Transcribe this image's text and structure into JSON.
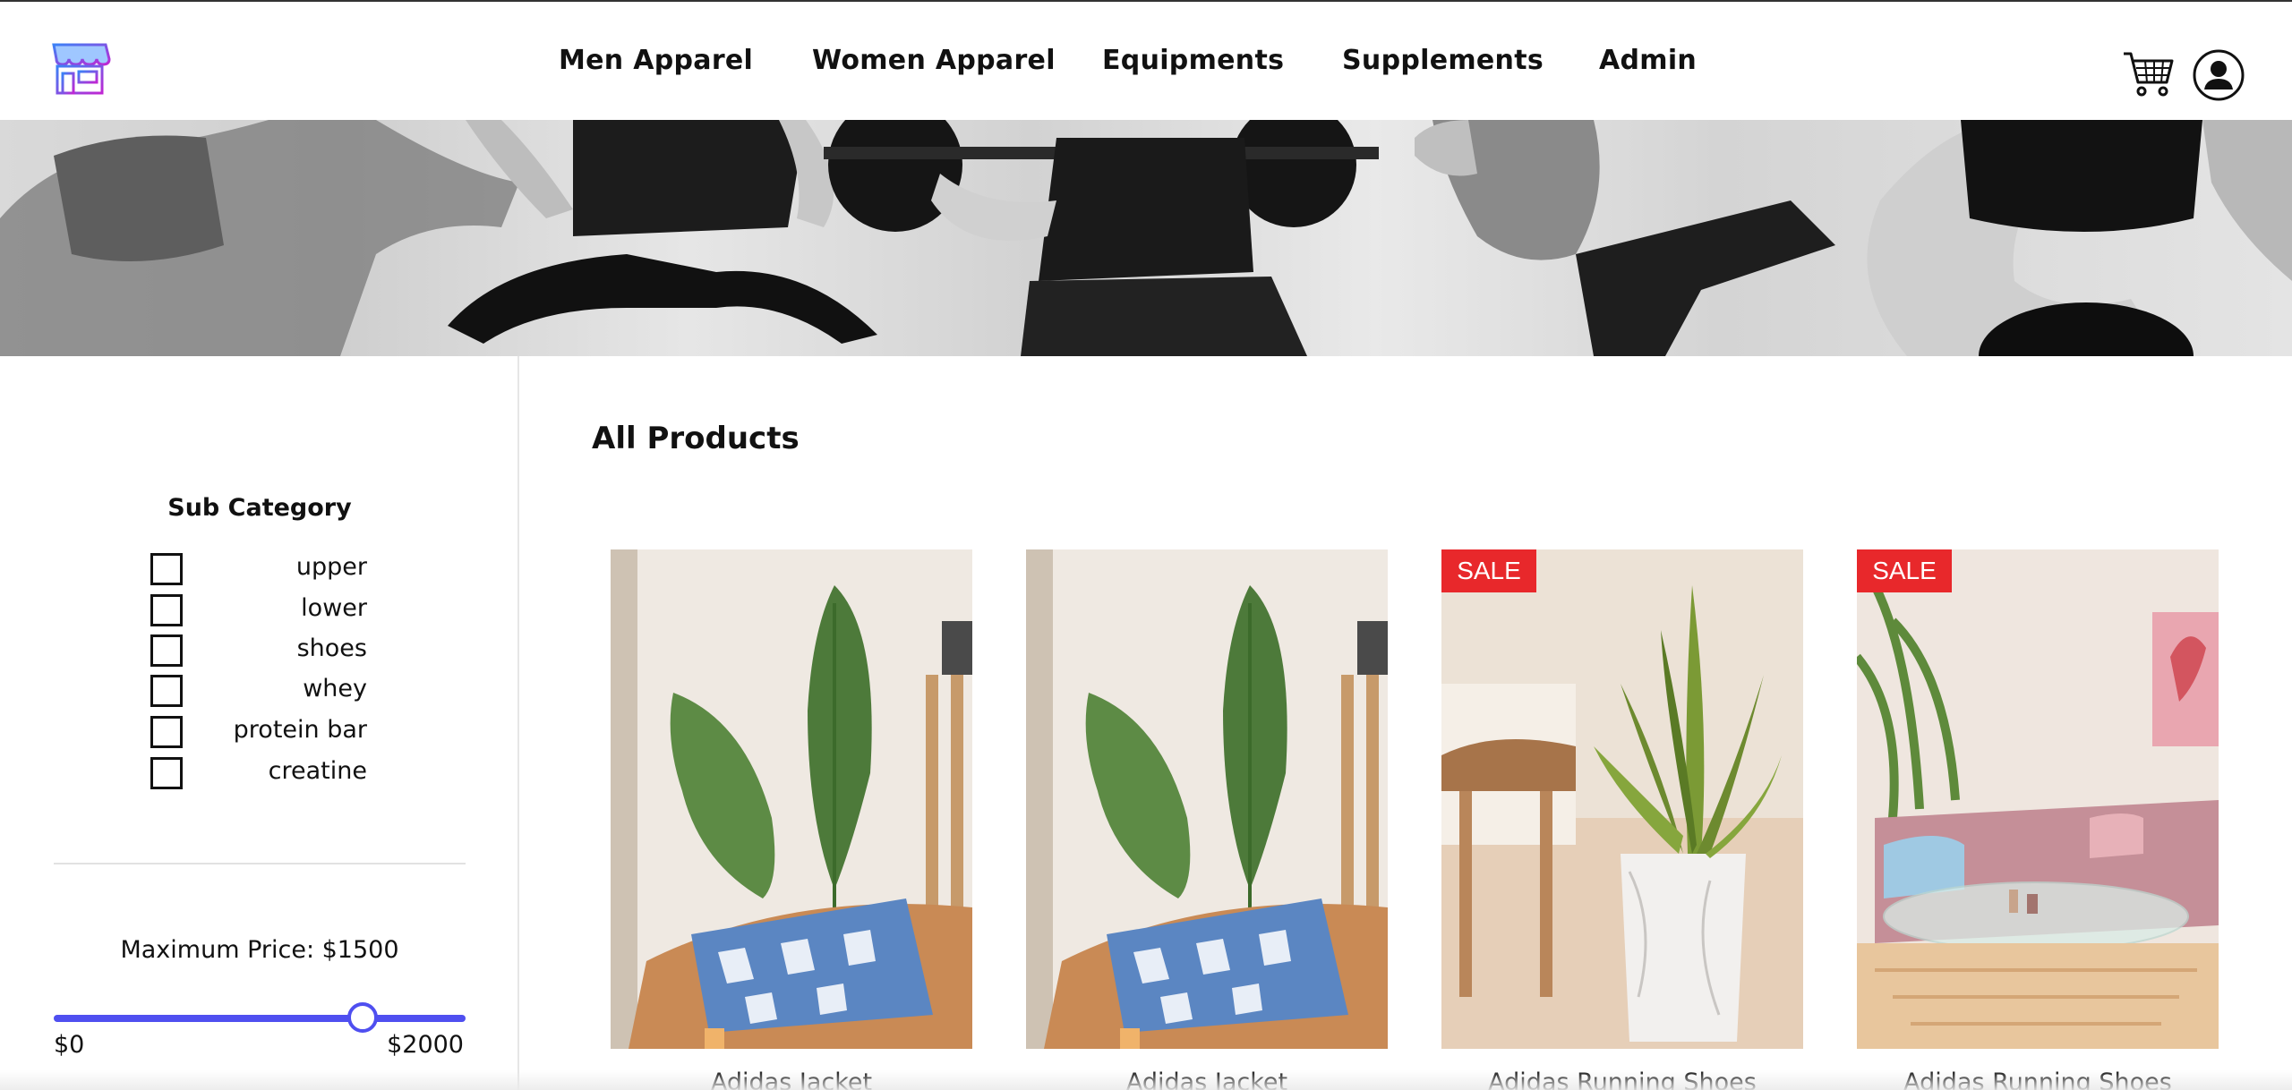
{
  "header": {
    "logo_icon": "storefront-icon",
    "nav": [
      {
        "label": "Men Apparel"
      },
      {
        "label": "Women Apparel"
      },
      {
        "label": "Equipments"
      },
      {
        "label": "Supplements"
      },
      {
        "label": "Admin"
      }
    ],
    "cart_icon": "cart-icon",
    "user_icon": "user-account-icon"
  },
  "banner": {
    "image": "fitness-athletes-grayscale-banner"
  },
  "sidebar": {
    "sub_category_title": "Sub Category",
    "filters": [
      {
        "label": "upper",
        "checked": false
      },
      {
        "label": "lower",
        "checked": false
      },
      {
        "label": "shoes",
        "checked": false
      },
      {
        "label": "whey",
        "checked": false
      },
      {
        "label": "protein bar",
        "checked": false
      },
      {
        "label": "creatine",
        "checked": false
      }
    ],
    "price": {
      "label": "Maximum Price: $1500",
      "min_label": "$0",
      "max_label": "$2000",
      "min": 0,
      "max": 2000,
      "value": 1500
    }
  },
  "main": {
    "title": "All Products",
    "products": [
      {
        "name": "Adidas Jacket",
        "sale": false,
        "badge": "",
        "image": "banana-leaf-plant-on-leather-sofa"
      },
      {
        "name": "Adidas Jacket",
        "sale": false,
        "badge": "",
        "image": "banana-leaf-plant-on-leather-sofa"
      },
      {
        "name": "Adidas Running Shoes",
        "sale": true,
        "badge": "SALE",
        "image": "snake-plant-in-marble-pot"
      },
      {
        "name": "Adidas Running Shoes",
        "sale": true,
        "badge": "SALE",
        "image": "pink-velvet-sofa-living-room"
      }
    ]
  },
  "colors": {
    "accent": "#4f4ff0",
    "sale_badge": "#e8282b",
    "logo_gradient_start": "#3b82f6",
    "logo_gradient_end": "#c026d3"
  }
}
